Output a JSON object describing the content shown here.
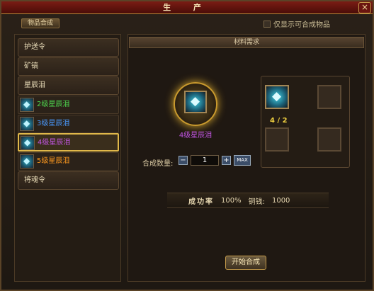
{
  "window": {
    "title": "生 产",
    "close_label": "×"
  },
  "tab": {
    "label": "物品合成"
  },
  "filter": {
    "only_craftable_label": "仅显示可合成物品",
    "checked": false
  },
  "categories": [
    {
      "label": "护送令"
    },
    {
      "label": "矿镐"
    },
    {
      "label": "星辰泪"
    }
  ],
  "items": [
    {
      "label": "2级星辰泪",
      "color": "#4fd84f",
      "icon": "gem-icon"
    },
    {
      "label": "3级星辰泪",
      "color": "#4a9aff",
      "icon": "gem-icon"
    },
    {
      "label": "4级星辰泪",
      "color": "#c055e0",
      "icon": "gem-icon",
      "selected": true
    },
    {
      "label": "5级星辰泪",
      "color": "#ff9a1f",
      "icon": "gem-icon"
    }
  ],
  "last_category": {
    "label": "将魂令"
  },
  "materials": {
    "title": "材料需求",
    "product_name": "4级星辰泪",
    "required_count": "4 / 2"
  },
  "quantity": {
    "label": "合成数量:",
    "value": "1",
    "minus": "−",
    "plus": "+",
    "max_label": "MAX"
  },
  "rates": {
    "success_label": "成功率",
    "success_value": "100%",
    "cost_label": "铜钱:",
    "cost_value": "1000"
  },
  "actions": {
    "start_label": "开始合成"
  }
}
